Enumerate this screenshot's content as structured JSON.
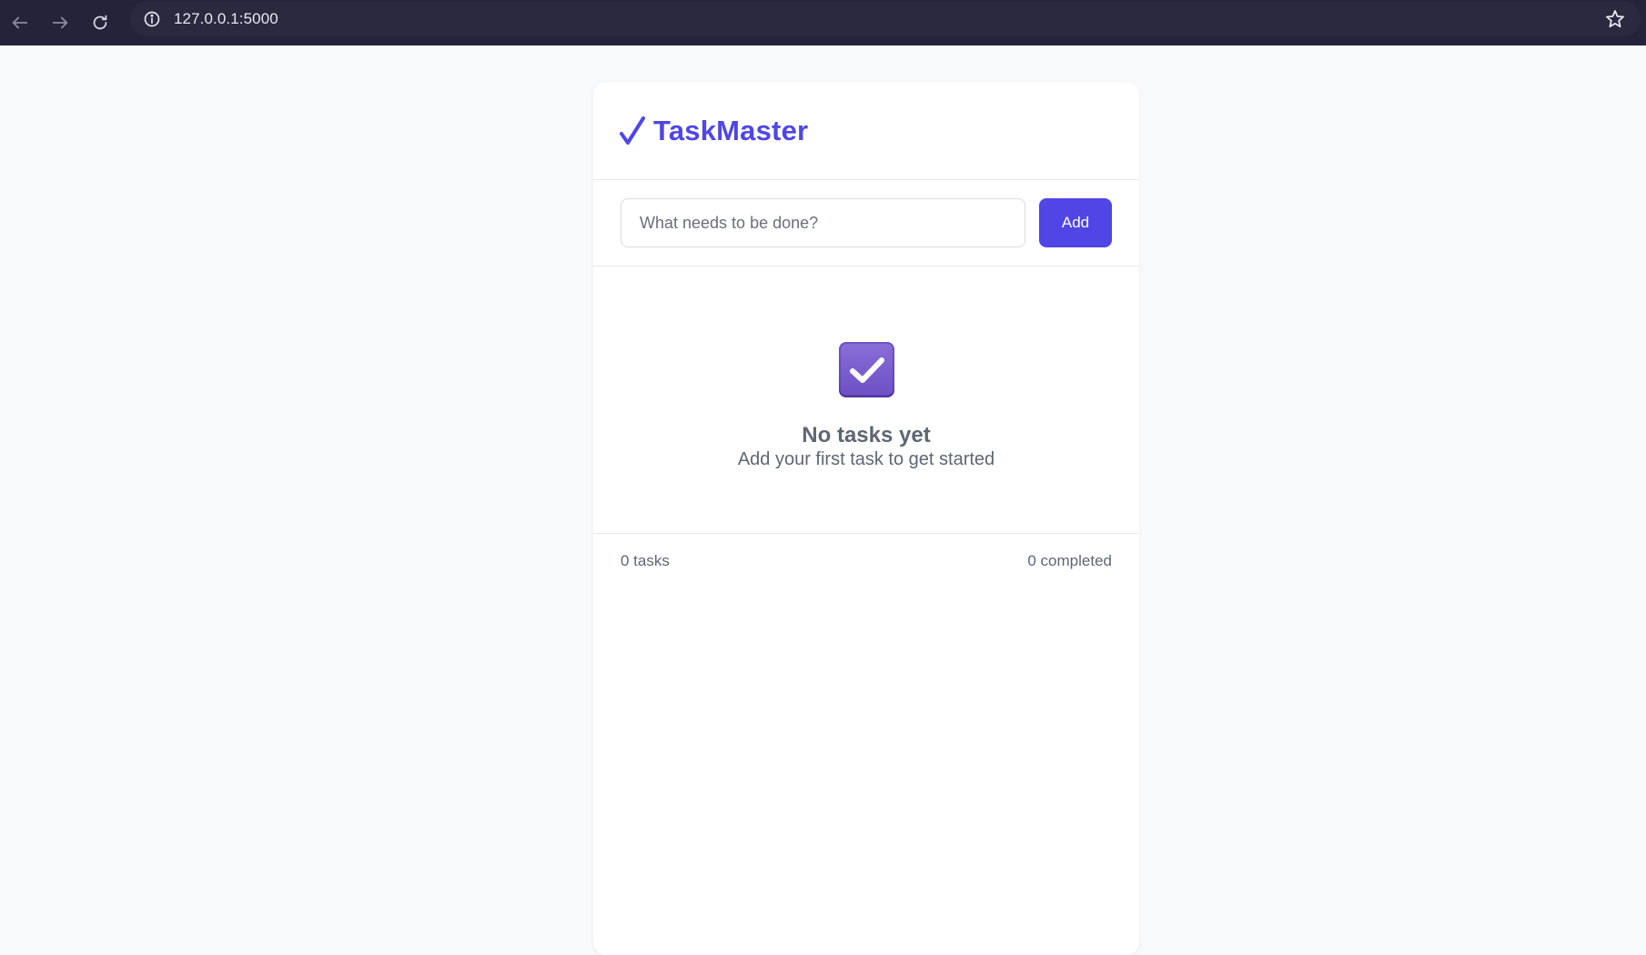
{
  "browser": {
    "url": "127.0.0.1:5000",
    "icons": {
      "back": "arrow-left-icon",
      "forward": "arrow-right-icon",
      "reload": "reload-icon",
      "info": "info-icon",
      "bookmark": "star-icon"
    }
  },
  "app": {
    "title": "TaskMaster",
    "brand_color": "#4f46e5"
  },
  "add_task": {
    "placeholder": "What needs to be done?",
    "button_label": "Add"
  },
  "empty_state": {
    "icon": "checkbox-checked-icon",
    "title": "No tasks yet",
    "subtitle": "Add your first task to get started"
  },
  "footer": {
    "task_count": "0 tasks",
    "completed_count": "0 completed"
  }
}
